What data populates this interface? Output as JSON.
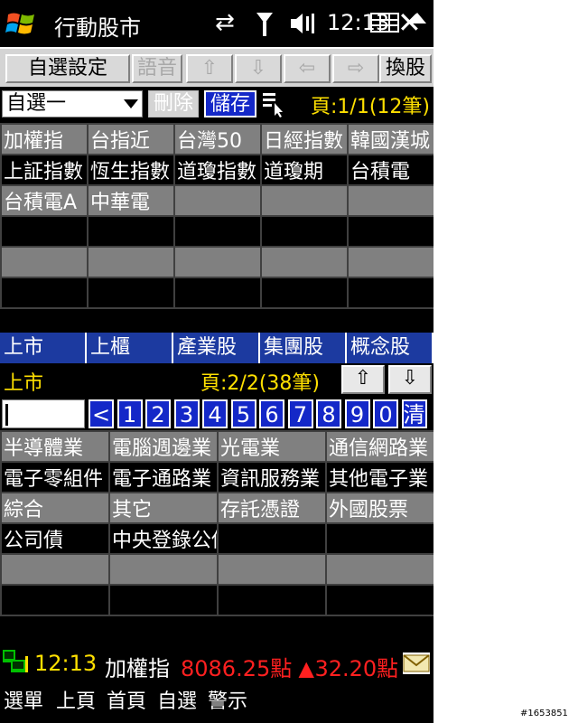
{
  "status": {
    "app_title": "行動股市",
    "time": "12:13"
  },
  "toolbar": {
    "watchlist_settings": "自選設定",
    "voice": "語音",
    "switch_stock": "換股"
  },
  "selector": {
    "group_value": "自選一",
    "delete_label": "刪除",
    "save_label": "儲存",
    "page_info": "頁:1/1(12筆)"
  },
  "watchlist": {
    "rows": [
      [
        "加權指",
        "台指近",
        "台灣50",
        "日經指數",
        "韓國漢城"
      ],
      [
        "上証指數",
        "恆生指數",
        "道瓊指數",
        "道瓊期",
        "台積電"
      ],
      [
        "台積電A",
        "中華電",
        "",
        "",
        ""
      ],
      [
        "",
        "",
        "",
        "",
        ""
      ],
      [
        "",
        "",
        "",
        "",
        ""
      ],
      [
        "",
        "",
        "",
        "",
        ""
      ]
    ]
  },
  "tabs": [
    "上市",
    "上櫃",
    "產業股",
    "集團股",
    "概念股"
  ],
  "category": {
    "market_label": "上市",
    "page_info": "頁:2/2(38筆)",
    "nav_keys": [
      "<",
      "1",
      "2",
      "3",
      "4",
      "5",
      "6",
      "7",
      "8",
      "9",
      "0",
      "清"
    ]
  },
  "industry": {
    "rows": [
      [
        "半導體業",
        "電腦週邊業",
        "光電業",
        "通信網路業"
      ],
      [
        "電子零組件",
        "電子通路業",
        "資訊服務業",
        "其他電子業"
      ],
      [
        "綜合",
        "其它",
        "存託憑證",
        "外國股票"
      ],
      [
        "公司債",
        "中央登錄公債",
        "",
        ""
      ],
      [
        "",
        "",
        "",
        ""
      ],
      [
        "",
        "",
        "",
        ""
      ]
    ]
  },
  "ticker": {
    "time": "12:13",
    "index_name": "加權指",
    "value": "8086.25點",
    "change": "▲32.20點"
  },
  "softkeys": [
    "選單",
    "上頁",
    "首頁",
    "自選",
    "警示"
  ],
  "watermark": "#1653851",
  "colors": {
    "accent_blue": "#1428c8",
    "tab_blue": "#1c3aa0",
    "highlight_yellow": "#ffe000",
    "up_red": "#ff2020"
  }
}
